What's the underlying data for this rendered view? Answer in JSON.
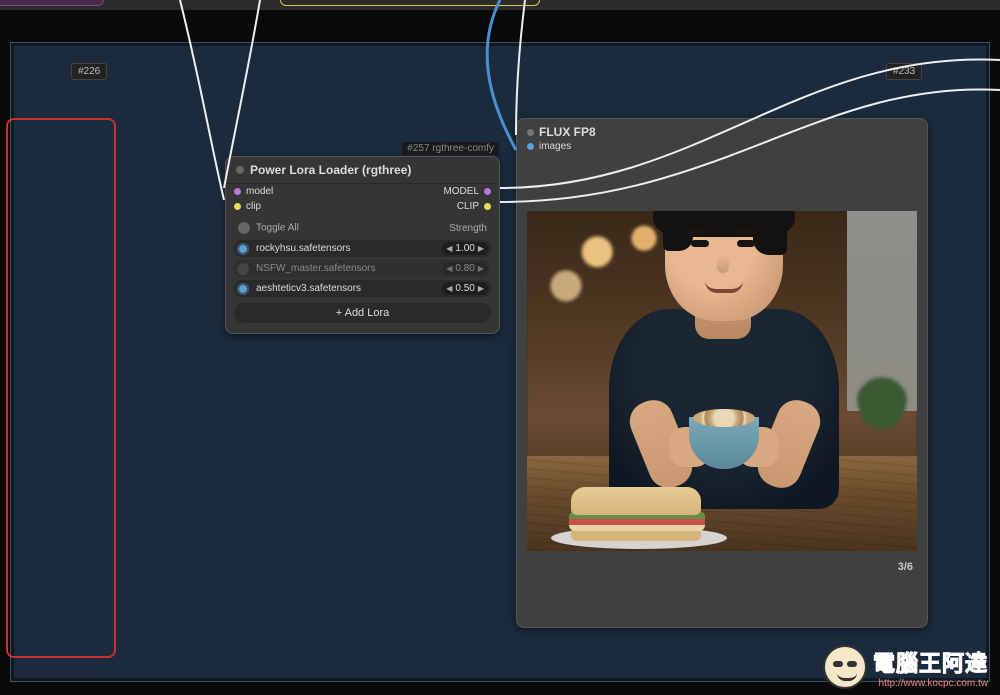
{
  "badges": {
    "n226": "#226",
    "n233": "#233",
    "n257": "#257 rgthree-comfy"
  },
  "lora": {
    "title": "Power Lora Loader (rgthree)",
    "in_model": "model",
    "in_clip": "clip",
    "out_model": "MODEL",
    "out_clip": "CLIP",
    "toggle_all": "Toggle All",
    "strength_hdr": "Strength",
    "items": [
      {
        "name": "rockyhsu.safetensors",
        "strength": "1.00",
        "on": true
      },
      {
        "name": "NSFW_master.safetensors",
        "strength": "0.80",
        "on": false
      },
      {
        "name": "aeshteticv3.safetensors",
        "strength": "0.50",
        "on": true
      }
    ],
    "add": "+  Add Lora"
  },
  "preview": {
    "title": "FLUX FP8",
    "images": "images",
    "close": "x",
    "pager": "3/6"
  },
  "watermark": {
    "cn": "電腦王阿達",
    "url": "http://www.kocpc.com.tw"
  }
}
